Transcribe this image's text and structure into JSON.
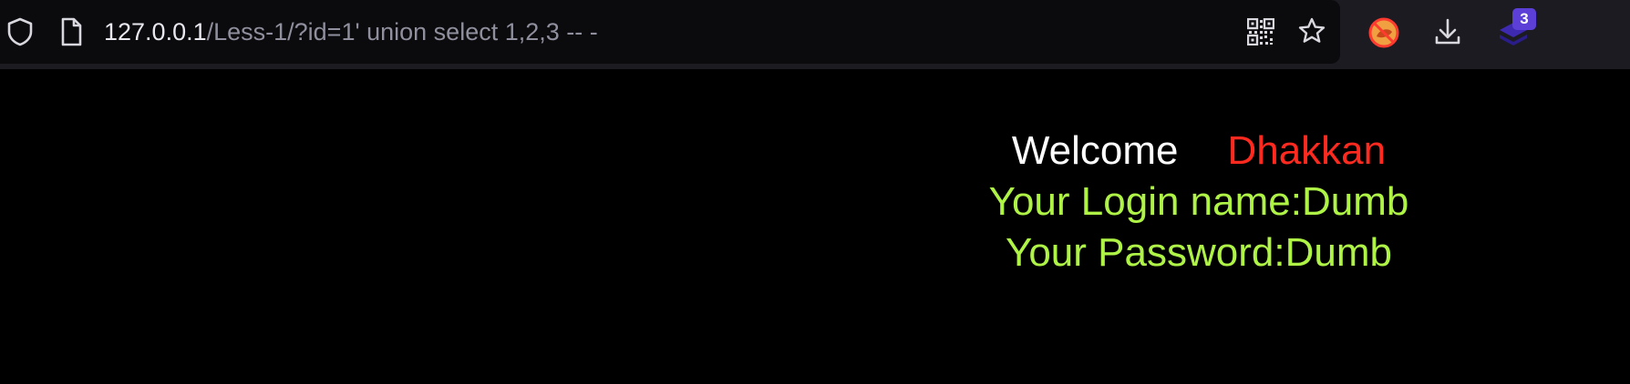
{
  "browser": {
    "url_host": "127.0.0.1",
    "url_path": "/Less-1/?id=1' union select 1,2,3 -- -",
    "extension_badge_count": "3",
    "icons": [
      "shield-icon",
      "page-icon",
      "qr-code-icon",
      "bookmark-star-icon",
      "extension-icon",
      "download-icon",
      "extension-stack-icon"
    ],
    "colors": {
      "toolbar_bg": "#1c1b22",
      "urlbar_bg": "#0b0b0e",
      "badge_bg": "#5b3fd6"
    }
  },
  "page": {
    "welcome_label": "Welcome",
    "user_name": "Dhakkan",
    "login_line": "Your Login name:Dumb",
    "password_line": "Your Password:Dumb",
    "colors": {
      "background": "#000000",
      "welcome": "#ffffff",
      "user_name": "#ff2a1f",
      "info": "#aef346"
    }
  }
}
